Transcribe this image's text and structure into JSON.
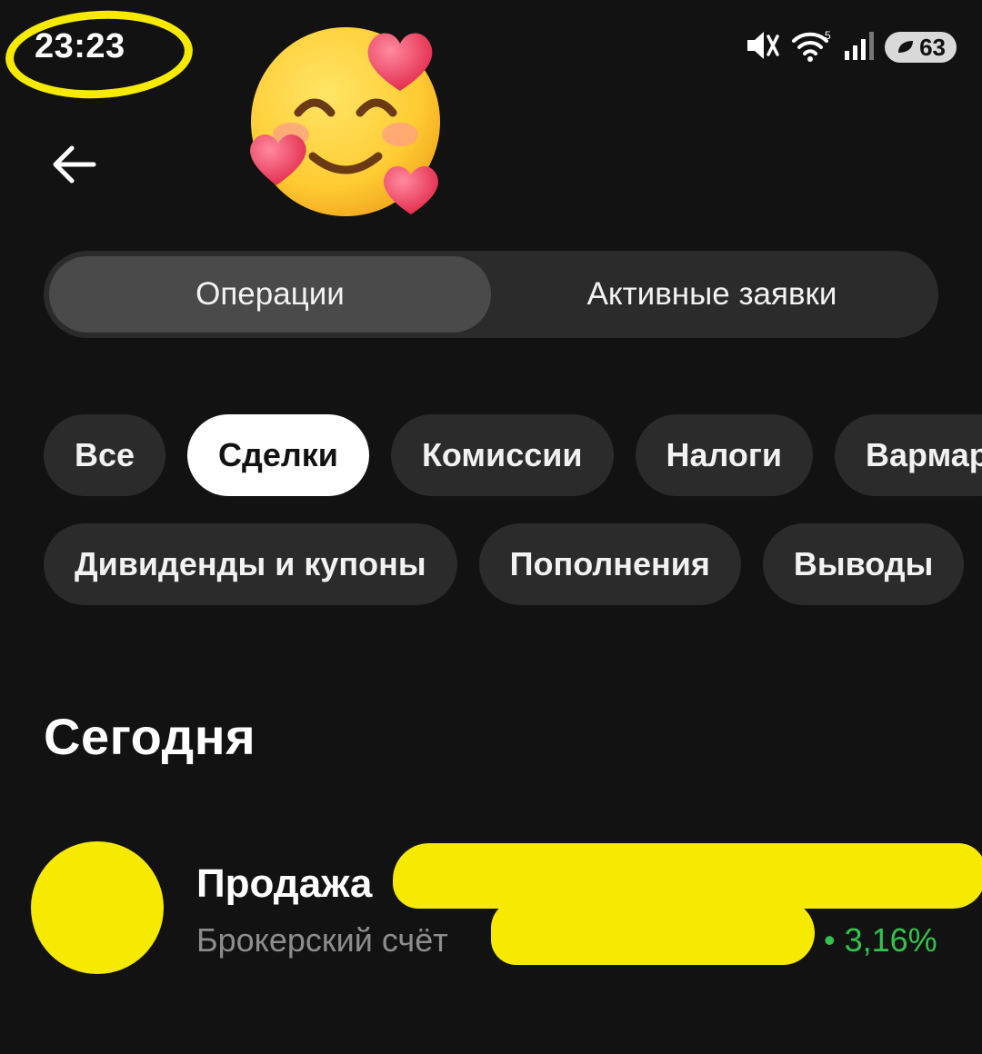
{
  "status_bar": {
    "time": "23:23",
    "battery": "63",
    "icons": [
      "mute-icon",
      "wifi-icon",
      "signal-icon",
      "battery-icon"
    ]
  },
  "header": {
    "back_icon": "arrow-left-icon",
    "sticker": "smiling-face-with-hearts"
  },
  "tabs": [
    {
      "label": "Операции",
      "active": true
    },
    {
      "label": "Активные заявки",
      "active": false
    }
  ],
  "filters": {
    "row1": [
      {
        "label": "Все",
        "active": false
      },
      {
        "label": "Сделки",
        "active": true
      },
      {
        "label": "Комиссии",
        "active": false
      },
      {
        "label": "Налоги",
        "active": false
      },
      {
        "label": "Вармар",
        "active": false
      }
    ],
    "row2": [
      {
        "label": "Дивиденды и купоны",
        "active": false
      },
      {
        "label": "Пополнения",
        "active": false
      },
      {
        "label": "Выводы",
        "active": false
      }
    ]
  },
  "section": {
    "title": "Сегодня"
  },
  "operations": [
    {
      "title": "Продажа",
      "subtitle": "Брокерский счёт",
      "change": "• 3,16%"
    }
  ],
  "colors": {
    "background": "#121212",
    "chip": "#2b2b2b",
    "highlight": "#f5ea00",
    "positive": "#33c24d",
    "muted_text": "#8d8d8d"
  }
}
